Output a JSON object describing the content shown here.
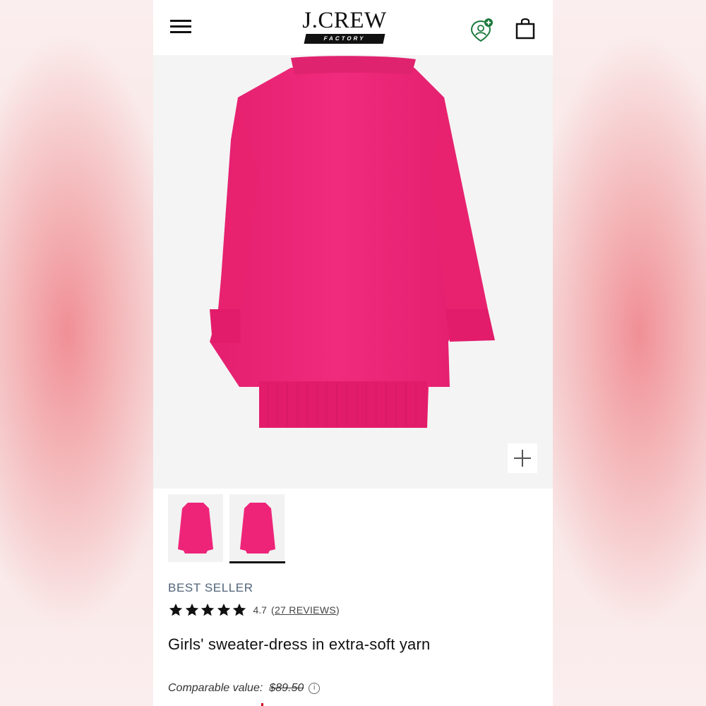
{
  "header": {
    "brand": "J.CREW",
    "brand_sub": "FACTORY"
  },
  "product": {
    "badge": "BEST SELLER",
    "rating": 4.7,
    "rating_text": "4.7",
    "reviews_open": "(",
    "reviews_label": "27 REVIEWS",
    "reviews_close": ")",
    "title": "Girls' sweater-dress in extra-soft yarn",
    "comparable_label": "Comparable value:",
    "comparable_price": "$89.50",
    "info_glyph": "i"
  },
  "gallery": {
    "selected_index": 1,
    "thumbnail_count": 2
  },
  "colors": {
    "sweater": "#ee2479",
    "badge_text": "#51647a",
    "account_green": "#1e7a3e"
  },
  "icons": [
    "menu-icon",
    "account-icon",
    "bag-icon",
    "zoom-plus-icon",
    "star-icon",
    "info-icon"
  ]
}
